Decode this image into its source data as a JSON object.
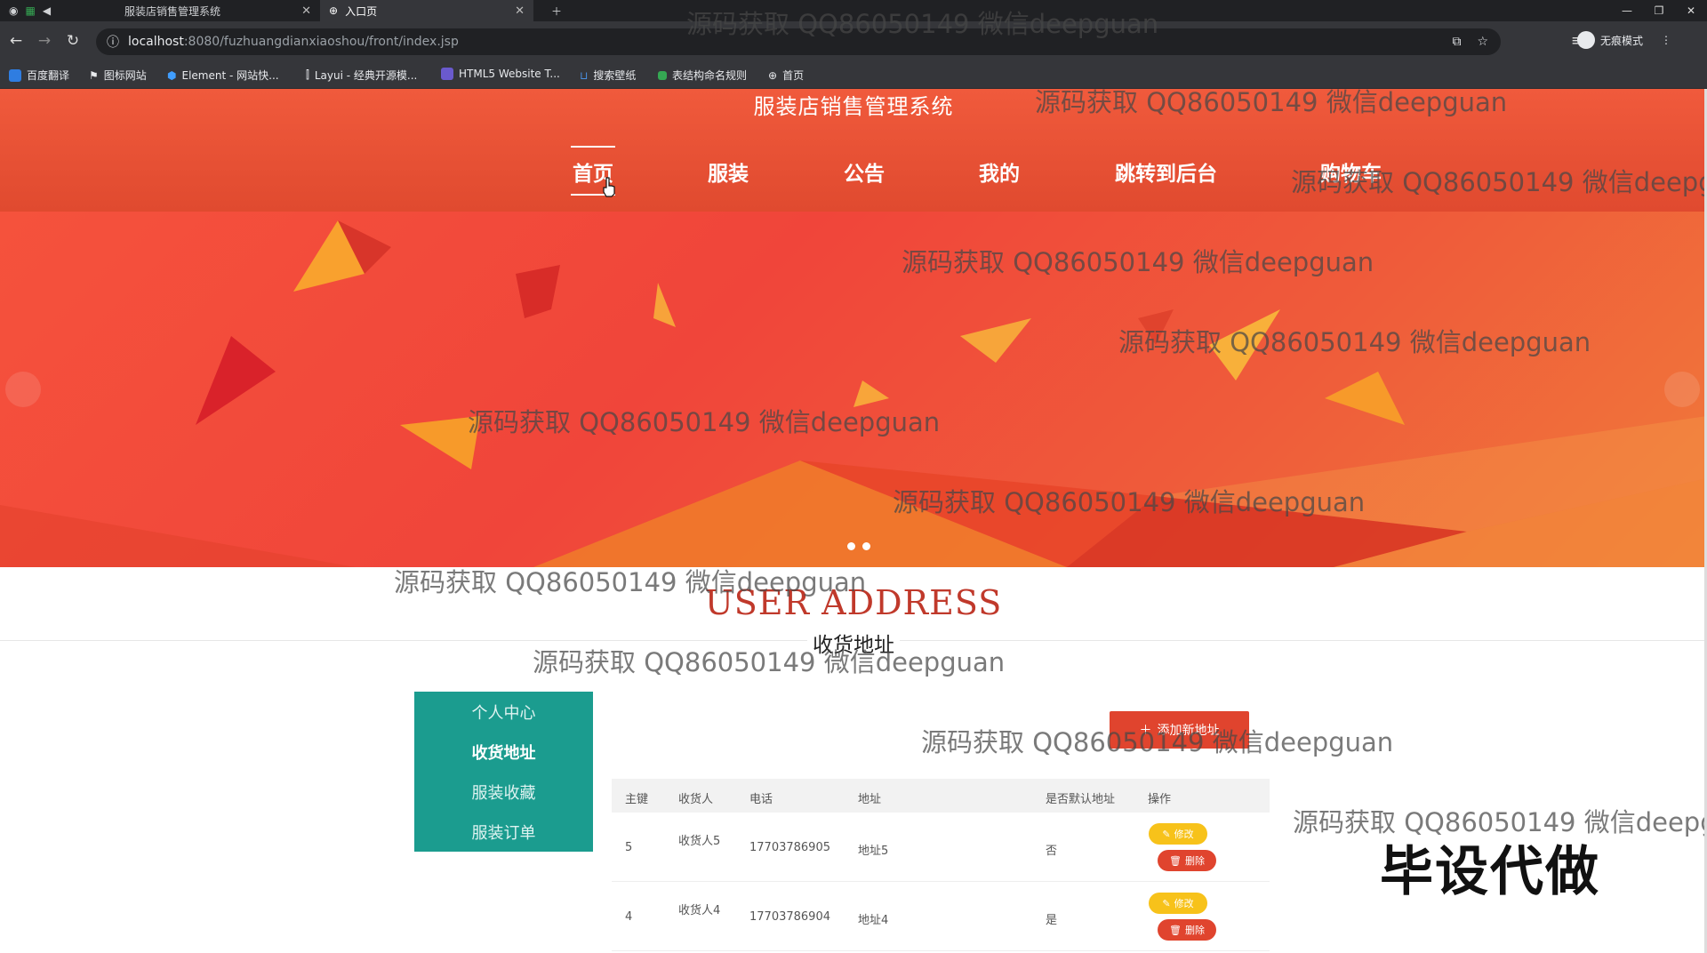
{
  "browser": {
    "tabs": [
      {
        "title": "服装店销售管理系统",
        "active": false
      },
      {
        "title": "入口页",
        "active": true
      }
    ],
    "url_host": "localhost",
    "url_path": ":8080/fuzhuangdianxiaoshou/front/index.jsp",
    "profile_label": "无痕模式",
    "bookmarks": [
      "百度翻译",
      "图标网站",
      "Element - 网站快...",
      "Layui - 经典开源模...",
      "HTML5 Website T...",
      "搜索壁纸",
      "表结构命名规则",
      "首页"
    ]
  },
  "site": {
    "title": "服装店销售管理系统",
    "nav": [
      "首页",
      "服装",
      "公告",
      "我的",
      "跳转到后台",
      "购物车"
    ]
  },
  "section": {
    "title_en": "USER ADDRESS",
    "title_cn": "收货地址"
  },
  "side_menu": [
    "个人中心",
    "收货地址",
    "服装收藏",
    "服装订单"
  ],
  "add_button": "添加新地址",
  "table": {
    "columns": [
      "主键",
      "收货人",
      "电话",
      "地址",
      "是否默认地址",
      "操作"
    ],
    "rows": [
      {
        "id": "5",
        "receiver": "收货人5",
        "phone": "17703786905",
        "address": "地址5",
        "default": "否"
      },
      {
        "id": "4",
        "receiver": "收货人4",
        "phone": "17703786904",
        "address": "地址4",
        "default": "是"
      }
    ],
    "edit_label": "修改",
    "delete_label": "删除"
  },
  "watermark": "源码获取 QQ86050149 微信deepguan",
  "promo": "毕设代做",
  "colors": {
    "header": "#e9533a",
    "menu": "#1b9c8f",
    "accent": "#e0442e",
    "edit": "#f7c21a",
    "title_en": "#c0392b"
  }
}
